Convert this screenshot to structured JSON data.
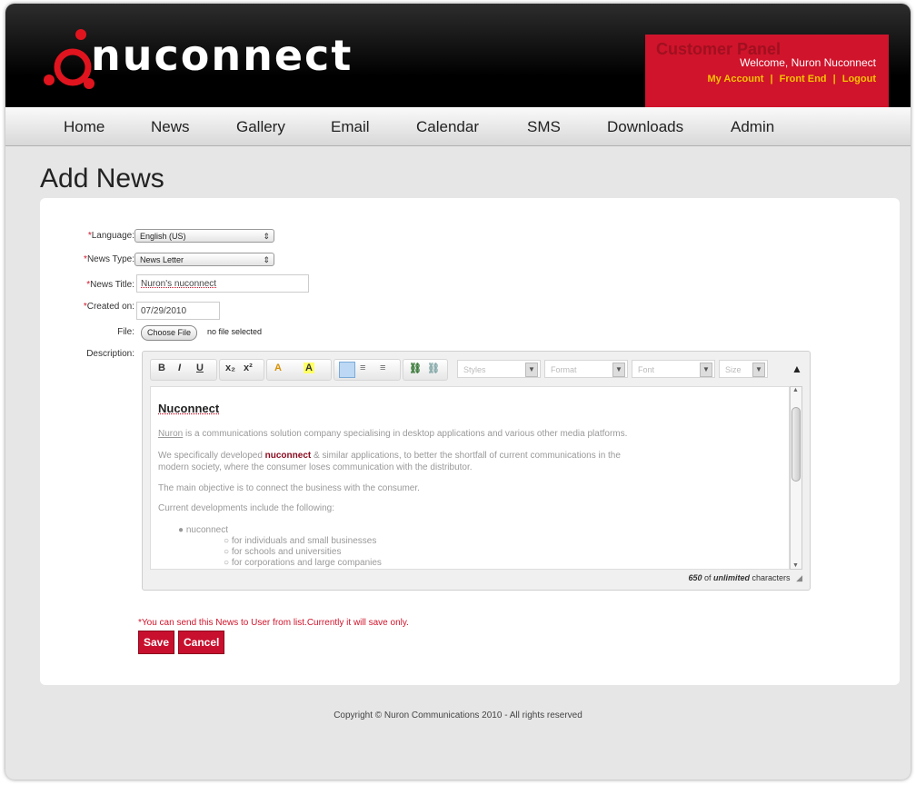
{
  "brand": {
    "name": "nuconnect"
  },
  "panel": {
    "title": "Customer Panel",
    "welcome": "Welcome, Nuron Nuconnect",
    "links": [
      "My Account",
      "Front End",
      "Logout"
    ],
    "separator": "|"
  },
  "nav": [
    "Home",
    "News",
    "Gallery",
    "Email",
    "Calendar",
    "SMS",
    "Downloads",
    "Admin"
  ],
  "page": {
    "title": "Add News"
  },
  "form": {
    "language": {
      "label": "Language:",
      "value": "English (US)"
    },
    "news_type": {
      "label": "News Type:",
      "value": "News Letter"
    },
    "news_title": {
      "label": "News Title:",
      "value": "Nuron's nuconnect"
    },
    "created_on": {
      "label": "Created on:",
      "value": "07/29/2010"
    },
    "file": {
      "label": "File:",
      "button": "Choose File",
      "status": "no file selected"
    },
    "description": {
      "label": "Description:"
    },
    "required_mark": "*"
  },
  "editor": {
    "toolbar": {
      "bold": "B",
      "italic": "I",
      "underline": "U",
      "subscript": "x₂",
      "superscript": "x²",
      "text_color": "A",
      "bg_color": "A",
      "styles": "Styles",
      "format": "Format",
      "font": "Font",
      "size": "Size"
    },
    "content": {
      "heading": "Nuconnect",
      "p1_link": "Nuron",
      "p1_rest": " is a communications solution company specialising in desktop applications and various other media platforms.",
      "p2_pre": "We specifically developed ",
      "p2_bold": "nuconnect",
      "p2_post": " & similar applications, to better the shortfall of current communications in the",
      "p2_line2": "modern society, where the consumer loses communication with the distributor.",
      "p3": "The main objective is to connect the business with the consumer.",
      "p4": "Current developments include the following:",
      "list_item": "nuconnect",
      "sub_items": [
        "for individuals and small businesses",
        "for schools and universities",
        "for corporations and large companies"
      ]
    },
    "status": {
      "count": "650",
      "of": " of ",
      "limit": "unlimited",
      "suffix": " characters"
    }
  },
  "note": "*You can send this News to User from list.Currently it will save only.",
  "buttons": {
    "save": "Save",
    "cancel": "Cancel"
  },
  "footer": "Copyright © Nuron Communications 2010 - All rights reserved",
  "colors": {
    "brand_red": "#d0142b",
    "link_yellow": "#f5c400",
    "header_black": "#000000"
  }
}
